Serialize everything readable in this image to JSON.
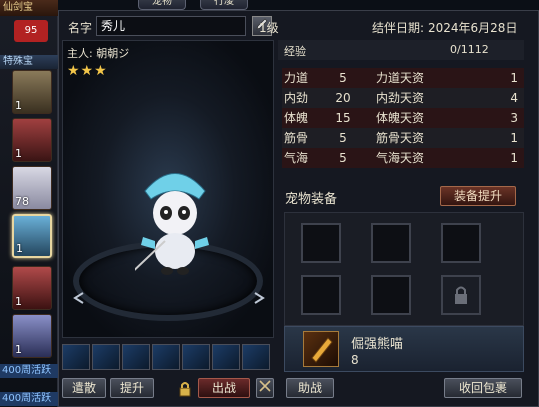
{
  "pet_list": {
    "top_label": "仙剑宝",
    "section_label": "特殊宝",
    "badge": "95",
    "slots": [
      {
        "count": "1"
      },
      {
        "count": "1"
      },
      {
        "count": "78"
      },
      {
        "count": "1"
      },
      {
        "count": "1"
      },
      {
        "count": "1"
      }
    ],
    "promo_1": "400周活跃",
    "promo_2": "400周活跃"
  },
  "tabs": [
    "宠物",
    "行凌"
  ],
  "pet": {
    "name_label": "名字",
    "name": "秀儿",
    "level": "1级",
    "companion_label": "结伴日期:",
    "companion_date": "2024年6月28日",
    "owner_label": "主人:",
    "owner": "朝朝ジ",
    "stars": "★★★"
  },
  "exp": {
    "label": "经验",
    "value": "0/1112"
  },
  "stats": [
    {
      "name": "力道",
      "value": "5",
      "aptitude_name": "力道天资",
      "aptitude": "1"
    },
    {
      "name": "内劲",
      "value": "20",
      "aptitude_name": "内劲天资",
      "aptitude": "4"
    },
    {
      "name": "体魄",
      "value": "15",
      "aptitude_name": "体魄天资",
      "aptitude": "3"
    },
    {
      "name": "筋骨",
      "value": "5",
      "aptitude_name": "筋骨天资",
      "aptitude": "1"
    },
    {
      "name": "气海",
      "value": "5",
      "aptitude_name": "气海天资",
      "aptitude": "1"
    }
  ],
  "equipment": {
    "title": "宠物装备",
    "upgrade_label": "装备提升"
  },
  "item": {
    "name": "倔强熊喵",
    "count": "8"
  },
  "buttons": {
    "release": "遣散",
    "promote": "提升",
    "battle": "出战",
    "assist": "助战",
    "retrieve": "收回包裹"
  },
  "colors": {
    "star": "#f3c64a",
    "accent_red": "#6a2a2a"
  }
}
